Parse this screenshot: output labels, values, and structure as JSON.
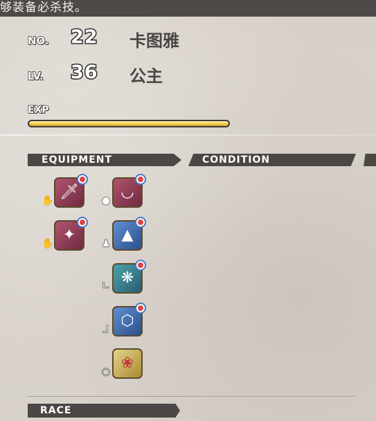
{
  "top_message": "够装备必杀技。",
  "character": {
    "no_label": "NO.",
    "no_value": "22",
    "name": "卡图雅",
    "lv_label": "LV.",
    "lv_value": "36",
    "title": "公主",
    "exp_label": "EXP",
    "exp_fraction": 1.0
  },
  "tabs": {
    "equipment": "EQUIPMENT",
    "condition": "CONDITION",
    "race": "RACE"
  },
  "equipment_slots": [
    {
      "slot": "weapon-1",
      "icon": "sword-icon",
      "type_icon": "hand-icon"
    },
    {
      "slot": "accessory-head",
      "icon": "circlet-icon",
      "type_icon": "head-icon"
    },
    {
      "slot": "weapon-2",
      "icon": "wand-icon",
      "type_icon": "hand-icon"
    },
    {
      "slot": "armor-body",
      "icon": "dress-icon",
      "type_icon": "body-icon"
    },
    {
      "slot": "armor-hands",
      "icon": "gloves-icon",
      "type_icon": "arm-icon"
    },
    {
      "slot": "armor-feet",
      "icon": "shoes-icon",
      "type_icon": "foot-icon"
    },
    {
      "slot": "accessory-ring",
      "icon": "ring-icon",
      "type_icon": "ring-type-icon"
    }
  ],
  "colors": {
    "topbar": "#4e4a47",
    "tab_bg": "#4b4744",
    "exp_fill": "#f6d35a",
    "slot_red": "#8a3a52",
    "slot_blue": "#3f6db0",
    "slot_teal": "#3a7a8a",
    "slot_gold": "#c9a94a"
  }
}
